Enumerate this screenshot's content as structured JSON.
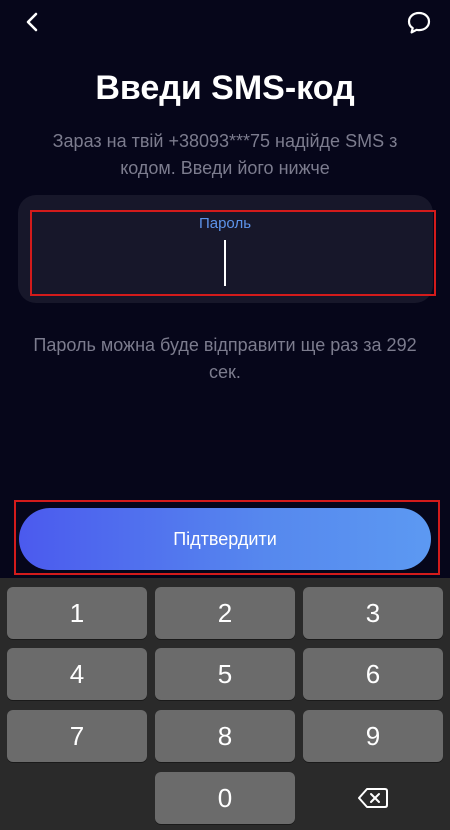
{
  "header": {
    "back_icon": "chevron-left-icon",
    "chat_icon": "chat-bubble-icon"
  },
  "title": "Введи SMS-код",
  "subtitle": "Зараз на твій +38093***75 надійде SMS з кодом. Введи його нижче",
  "code_field": {
    "label": "Пароль",
    "value": ""
  },
  "resend_hint": "Пароль можна буде відправити ще раз за 292 сек.",
  "confirm_button": {
    "label": "Підтвердити"
  },
  "colors": {
    "background": "#06061a",
    "field_background": "#17172a",
    "label_accent": "#5d93ea",
    "muted_text": "#7c7c8e",
    "button_gradient_start": "#4b5aee",
    "button_gradient_end": "#5c99f2",
    "highlight_border": "#d31b1b",
    "keyboard_background": "#2a2a2a",
    "key_background": "#6b6b6b"
  },
  "keypad": {
    "keys": [
      "1",
      "2",
      "3",
      "4",
      "5",
      "6",
      "7",
      "8",
      "9",
      "0"
    ],
    "backspace_icon": "backspace-icon"
  }
}
